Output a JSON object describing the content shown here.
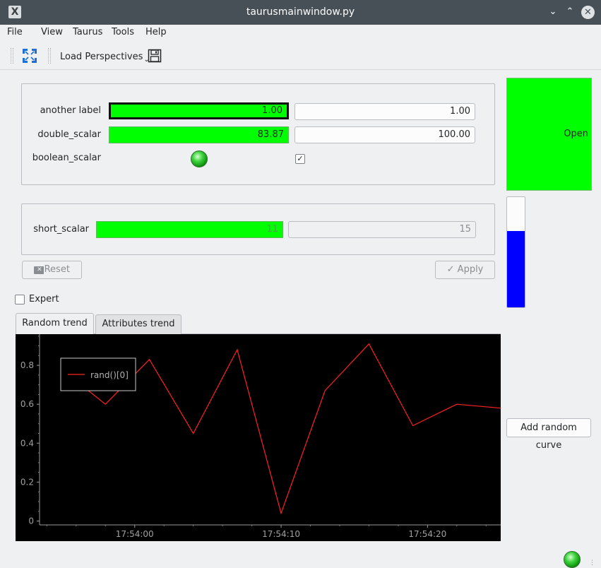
{
  "window": {
    "title": "taurusmainwindow.py",
    "app_icon_glyph": "X"
  },
  "menubar": {
    "items": [
      {
        "label": "File"
      },
      {
        "label": "View"
      },
      {
        "label": "Taurus"
      },
      {
        "label": "Tools"
      },
      {
        "label": "Help"
      }
    ]
  },
  "toolbar": {
    "fullscreen_icon": "fullscreen-icon",
    "load_perspectives_label": "Load Perspectives",
    "save_icon": "save-icon"
  },
  "form": {
    "rows": [
      {
        "label": "another label",
        "read_value": "1.00",
        "write_value": "1.00"
      },
      {
        "label": "double_scalar",
        "read_value": "83.87",
        "write_value": "100.00"
      },
      {
        "label": "boolean_scalar",
        "led_state": "on",
        "checked": true
      }
    ],
    "short": {
      "label": "short_scalar",
      "read_value": "11",
      "write_value": "15"
    },
    "reset_label": "Reset",
    "apply_label": "Apply",
    "expert_label": "Expert"
  },
  "state_panel": {
    "label": "Open",
    "color": "#00ff00"
  },
  "level_bar": {
    "fill_fraction": 0.69,
    "fill_color": "#0000ff"
  },
  "tabs": [
    {
      "label": "Random trend",
      "active": true
    },
    {
      "label": "Attributes trend",
      "active": false
    }
  ],
  "add_curve_label": "Add random curve",
  "chart_data": {
    "type": "line",
    "legend": [
      "rand()[0]"
    ],
    "x_ticks": [
      "17:54:00",
      "17:54:10",
      "17:54:20"
    ],
    "x_tick_seconds": [
      0,
      10,
      20
    ],
    "y_ticks": [
      "0",
      "0.2",
      "0.4",
      "0.6",
      "0.8"
    ],
    "ylim": [
      -0.02,
      0.96
    ],
    "xlim": [
      -6.5,
      25
    ],
    "series": [
      {
        "name": "rand()[0]",
        "color": "#ff2020",
        "x": [
          -5,
          -2,
          1,
          4,
          7,
          10,
          13,
          16,
          19,
          22,
          25
        ],
        "y": [
          0.78,
          0.6,
          0.83,
          0.45,
          0.88,
          0.04,
          0.67,
          0.91,
          0.49,
          0.6,
          0.58
        ]
      }
    ]
  }
}
